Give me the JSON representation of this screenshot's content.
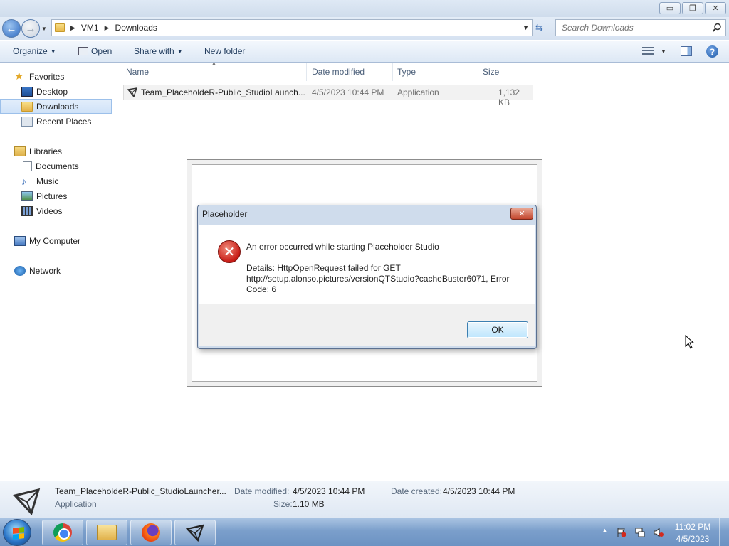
{
  "window": {
    "buttons": {
      "minimize": "▭",
      "maximize": "❐",
      "close": "✕"
    }
  },
  "address": {
    "crumbs": [
      "VM1",
      "Downloads"
    ],
    "search_placeholder": "Search Downloads"
  },
  "toolbar": {
    "organize": "Organize",
    "open": "Open",
    "share_with": "Share with",
    "new_folder": "New folder"
  },
  "nav": {
    "favorites": "Favorites",
    "desktop": "Desktop",
    "downloads": "Downloads",
    "recent_places": "Recent Places",
    "libraries": "Libraries",
    "documents": "Documents",
    "music": "Music",
    "pictures": "Pictures",
    "videos": "Videos",
    "my_computer": "My Computer",
    "network": "Network"
  },
  "columns": {
    "name": "Name",
    "date_modified": "Date modified",
    "type": "Type",
    "size": "Size"
  },
  "files": [
    {
      "name": "Team_PlaceholdeR-Public_StudioLaunch...",
      "date": "4/5/2023 10:44 PM",
      "type": "Application",
      "size": "1,132 KB"
    }
  ],
  "dialog": {
    "title": "Placeholder",
    "message": "An error occurred while starting Placeholder Studio",
    "details": "Details: HttpOpenRequest failed for GET http://setup.alonso.pictures/versionQTStudio?cacheBuster6071, Error Code: 6",
    "ok_label": "OK"
  },
  "details_pane": {
    "name": "Team_PlaceholdeR-Public_StudioLauncher...",
    "type": "Application",
    "date_modified_label": "Date modified:",
    "date_modified": "4/5/2023 10:44 PM",
    "date_created_label": "Date created:",
    "date_created": "4/5/2023 10:44 PM",
    "size_label": "Size:",
    "size": "1.10 MB"
  },
  "taskbar": {
    "time": "11:02 PM",
    "date": "4/5/2023"
  }
}
